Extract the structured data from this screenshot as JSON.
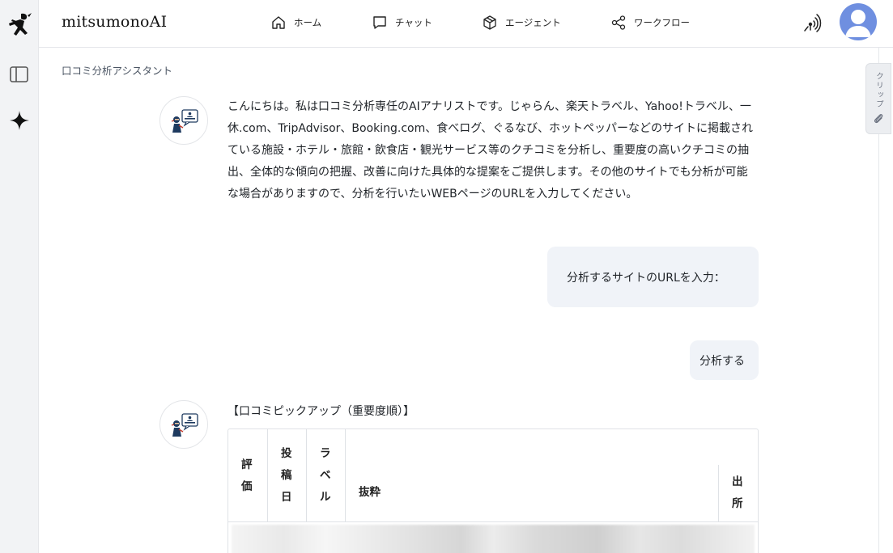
{
  "app": {
    "brand": "mitsumonoAI"
  },
  "nav": {
    "home": "ホーム",
    "chat": "チャット",
    "agent": "エージェント",
    "workflow": "ワークフロー"
  },
  "breadcrumb": "口コミ分析アシスタント",
  "clip_tab": {
    "label": "クリップ"
  },
  "messages": {
    "bot_intro": "こんにちは。私は口コミ分析専任のAIアナリストです。じゃらん、楽天トラベル、Yahoo!トラベル、一休.com、TripAdvisor、Booking.com、食べログ、ぐるなび、ホットペッパーなどのサイトに掲載されている施設・ホテル・旅館・飲食店・観光サービス等のクチコミを分析し、重要度の高いクチコミの抽出、全体的な傾向の把握、改善に向けた具体的な提案をご提供します。その他のサイトでも分析が可能な場合がありますので、分析を行いたいWEBページのURLを入力してください。",
    "user_1": "分析するサイトのURLを入力：",
    "user_2": "分析する",
    "pickup_title": "【口コミピックアップ（重要度順）】"
  },
  "table": {
    "headers": {
      "rating": "評価",
      "posted": "投稿日",
      "label": "ラベル",
      "excerpt": "抜粋",
      "source": "出所"
    }
  },
  "colors": {
    "rail_bg": "#f2f3f5",
    "bubble_bg": "#f0f3f8",
    "avatar_bg": "#6f8fe0"
  }
}
